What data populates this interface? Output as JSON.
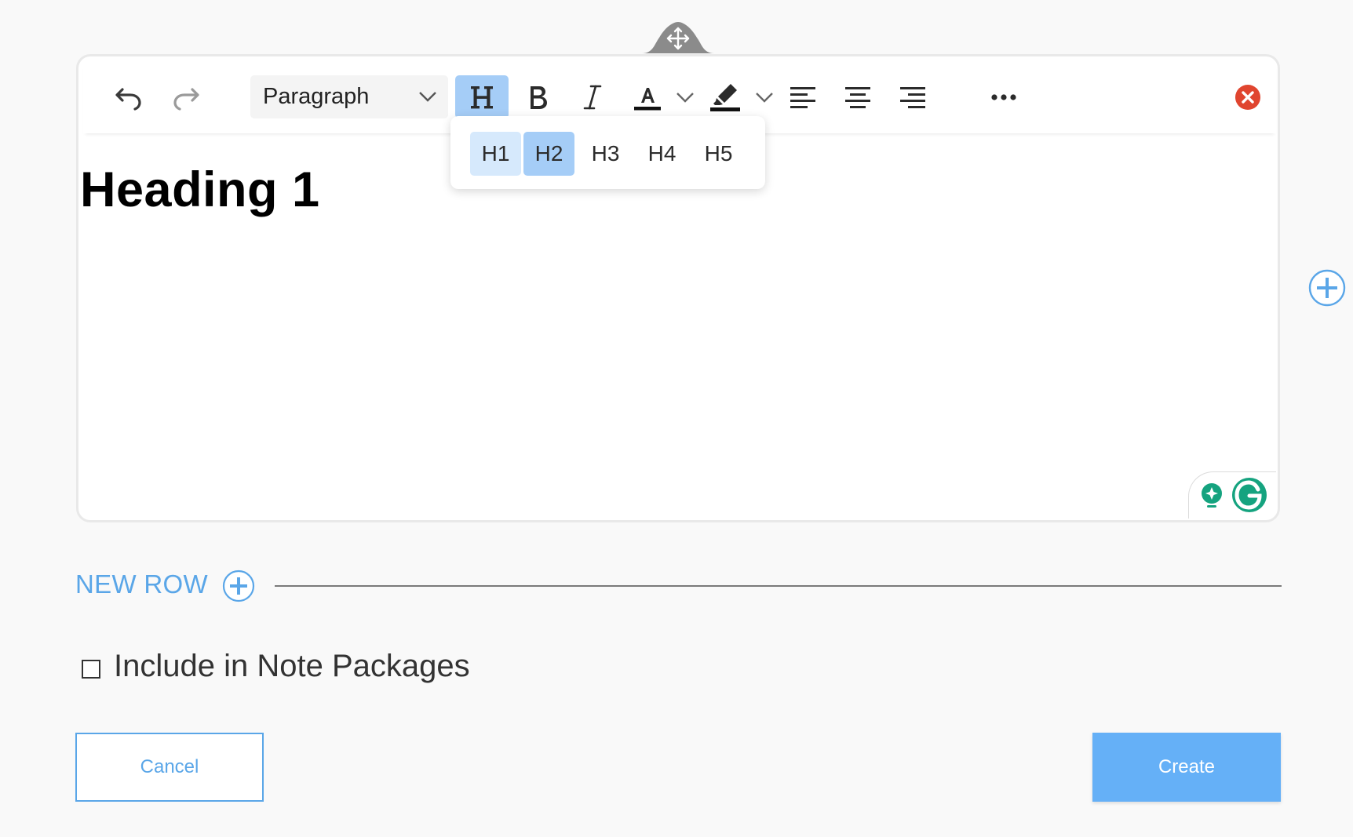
{
  "toolbar": {
    "undo_icon": "undo-icon",
    "redo_icon": "redo-icon",
    "block_format": "Paragraph",
    "heading_icon": "heading-icon",
    "bold_icon": "bold-icon",
    "italic_icon": "italic-icon",
    "font_color_icon": "font-color-icon",
    "highlight_icon": "highlight-icon",
    "align_left_icon": "align-left-icon",
    "align_center_icon": "align-center-icon",
    "align_right_icon": "align-right-icon",
    "more_icon": "more-icon",
    "close_icon": "close-icon"
  },
  "heading_menu": {
    "items": [
      "H1",
      "H2",
      "H3",
      "H4",
      "H5"
    ],
    "selected": "H2",
    "hovered": "H1"
  },
  "editor": {
    "content_heading": "Heading 1"
  },
  "new_row": {
    "label": "NEW ROW"
  },
  "options": {
    "include_label": "Include in Note Packages",
    "include_checked": false
  },
  "actions": {
    "cancel_label": "Cancel",
    "create_label": "Create"
  },
  "colors": {
    "accent": "#5aa6e8",
    "create_bg": "#65b0f7",
    "heading_active": "#a5cdf7",
    "close_red": "#e0452f",
    "grammarly_green": "#15a37f"
  }
}
